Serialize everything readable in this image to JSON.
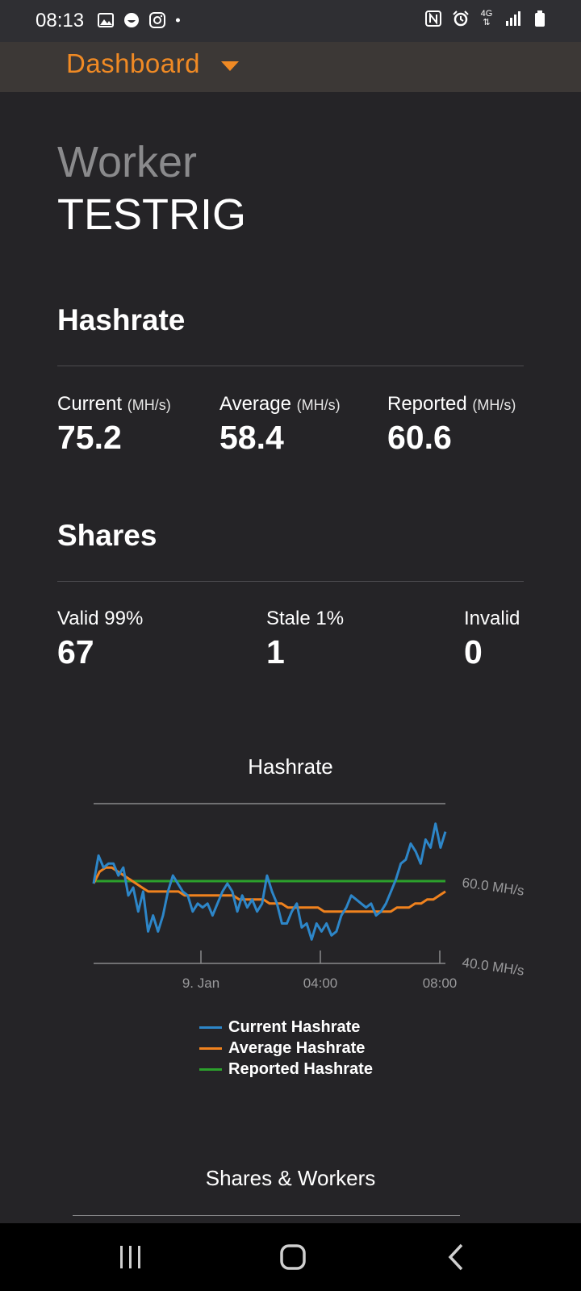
{
  "status_bar": {
    "time": "08:13",
    "left_icons": [
      "gallery-icon",
      "face-icon",
      "instagram-icon",
      "dot-icon"
    ],
    "right_icons": [
      "nfc-icon",
      "alarm-icon",
      "4g-icon",
      "signal-icon",
      "battery-icon"
    ],
    "network_label": "4G"
  },
  "appbar": {
    "title": "Dashboard",
    "accent": "#f08a24"
  },
  "worker": {
    "label": "Worker",
    "name": "TESTRIG"
  },
  "hashrate_section": {
    "title": "Hashrate",
    "metrics": [
      {
        "label": "Current",
        "unit": "(MH/s)",
        "value": "75.2"
      },
      {
        "label": "Average",
        "unit": "(MH/s)",
        "value": "58.4"
      },
      {
        "label": "Reported",
        "unit": "(MH/s)",
        "value": "60.6"
      }
    ]
  },
  "shares_section": {
    "title": "Shares",
    "metrics": [
      {
        "label": "Valid 99%",
        "value": "67"
      },
      {
        "label": "Stale 1%",
        "value": "1"
      },
      {
        "label": "Invalid",
        "value": "0"
      }
    ]
  },
  "chart_data": {
    "type": "line",
    "title": "Hashrate",
    "x_ticks": [
      "9. Jan",
      "04:00",
      "08:00"
    ],
    "y_ticks": [
      "60.0 MH/s",
      "40.0 MH/s"
    ],
    "ylim": [
      40,
      80
    ],
    "series": [
      {
        "name": "Current Hashrate",
        "color": "#2d86c8",
        "values": [
          60,
          67,
          64,
          65,
          65,
          62,
          64,
          57,
          59,
          53,
          58,
          48,
          52,
          48,
          52,
          58,
          62,
          60,
          58,
          57,
          53,
          55,
          54,
          55,
          52,
          55,
          58,
          60,
          58,
          53,
          57,
          54,
          56,
          53,
          55,
          62,
          58,
          55,
          50,
          50,
          53,
          55,
          49,
          50,
          46,
          50,
          48,
          50,
          47,
          48,
          52,
          54,
          57,
          56,
          55,
          54,
          55,
          52,
          53,
          55,
          58,
          61,
          65,
          66,
          70,
          68,
          65,
          71,
          69,
          75,
          69,
          73
        ]
      },
      {
        "name": "Average Hashrate",
        "color": "#f0821e",
        "values": [
          60,
          63,
          64,
          64,
          63,
          62,
          61,
          60,
          59,
          58,
          58,
          58,
          58,
          58,
          58,
          57,
          57,
          57,
          57,
          57,
          57,
          57,
          57,
          57,
          56,
          56,
          56,
          56,
          56,
          55,
          55,
          55,
          54,
          54,
          54,
          54,
          54,
          54,
          53,
          53,
          53,
          53,
          53,
          53,
          53,
          53,
          53,
          53,
          53,
          53,
          54,
          54,
          54,
          55,
          55,
          56,
          56,
          57,
          58
        ]
      },
      {
        "name": "Reported Hashrate",
        "color": "#2ca02c",
        "values": [
          60.6,
          60.6
        ]
      }
    ]
  },
  "second_chart": {
    "title": "Shares & Workers"
  },
  "navbar": {
    "icons": [
      "recent-apps-icon",
      "home-icon",
      "back-icon"
    ]
  }
}
